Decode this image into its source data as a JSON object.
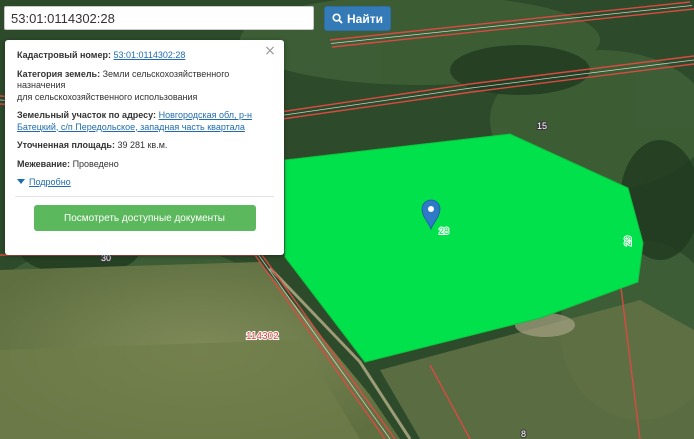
{
  "search": {
    "value": "53:01:0114302:28",
    "button_label": "Найти",
    "button_icon": "search-icon"
  },
  "info": {
    "cadastral_label": "Кадастровый номер:",
    "cadastral_value": "53:01:0114302:28",
    "category_label": "Категория земель:",
    "category_line1": "Земли сельскохозяйственного",
    "category_line2": "назначения",
    "category_line3": "для сельскохозяйственного использования",
    "address_label": "Земельный участок по адресу:",
    "address_line1": "Новгородская обл, р-н",
    "address_line2": "Батецкий, с/п Передольское, западная часть квартала",
    "area_label": "Уточненная площадь:",
    "area_value": "39 281 кв.м.",
    "survey_label": "Межевание:",
    "survey_value": "Проведено",
    "more_label": "Подробно",
    "docs_button": "Посмотреть доступные документы",
    "close_icon": "close-icon"
  },
  "map": {
    "labels": {
      "parcel_15": "15",
      "parcel_28": "28",
      "parcel_29": "29",
      "parcel_30": "30",
      "block": "114302",
      "parcel_8": "8"
    },
    "marker_icon": "map-pin-icon",
    "colors": {
      "parcel_fill": "#00e14c",
      "boundary": "#d94a43",
      "button_blue": "#337ab7",
      "button_green": "#5cb85c",
      "link": "#1f6bb0"
    }
  }
}
